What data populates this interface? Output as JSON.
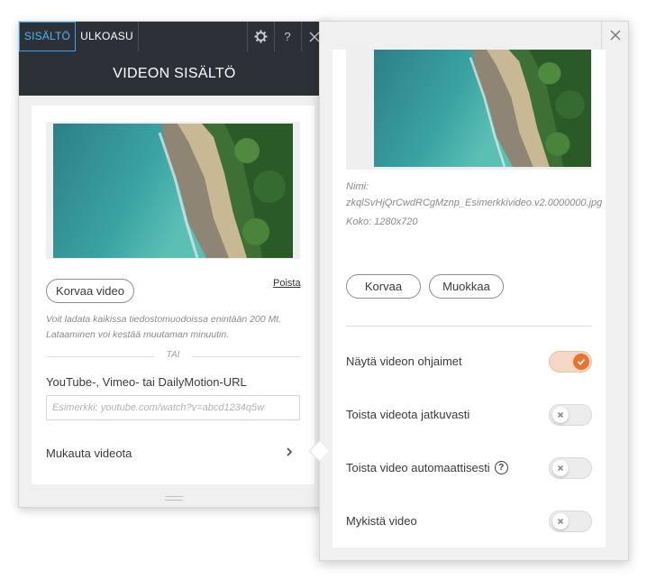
{
  "left_panel": {
    "tabs": [
      {
        "label": "SISÄLTÖ"
      },
      {
        "label": "ULKOASU"
      }
    ],
    "toolbar": {
      "settings_icon": "gear-icon",
      "help_label": "?",
      "close_icon": "close-icon"
    },
    "header_title": "VIDEON SISÄLTÖ",
    "replace_video_label": "Korvaa video",
    "remove_label": "Poista",
    "help_text": "Voit ladata kaikissa tiedostomuodoissa enintään 200 Mt. Lataaminen voi kestää muutaman minuutin.",
    "or_label": "TAI",
    "url_label": "YouTube-, Vimeo- tai DailyMotion-URL",
    "url_placeholder": "Esimerkki: youtube.com/watch?v=abcd1234q5w",
    "customize_label": "Mukauta videota"
  },
  "right_panel": {
    "name_label": "Nimi:",
    "file_name": "zkqlSvHjQrCwdRCgMznp_Esimerkkivideo.v2.0000000.jpg",
    "size_text": "Koko: 1280x720",
    "replace_label": "Korvaa",
    "edit_label": "Muokkaa",
    "toggles": [
      {
        "label": "Näytä videon ohjaimet",
        "on": true
      },
      {
        "label": "Toista videota jatkuvasti",
        "on": false
      },
      {
        "label": "Toista video automaattisesti",
        "on": false,
        "help": "?"
      },
      {
        "label": "Mykistä video",
        "on": false
      }
    ]
  },
  "colors": {
    "dark_bar": "#2b3136",
    "active_tab": "#3aa0ec",
    "toggle_on": "#e8732c"
  }
}
